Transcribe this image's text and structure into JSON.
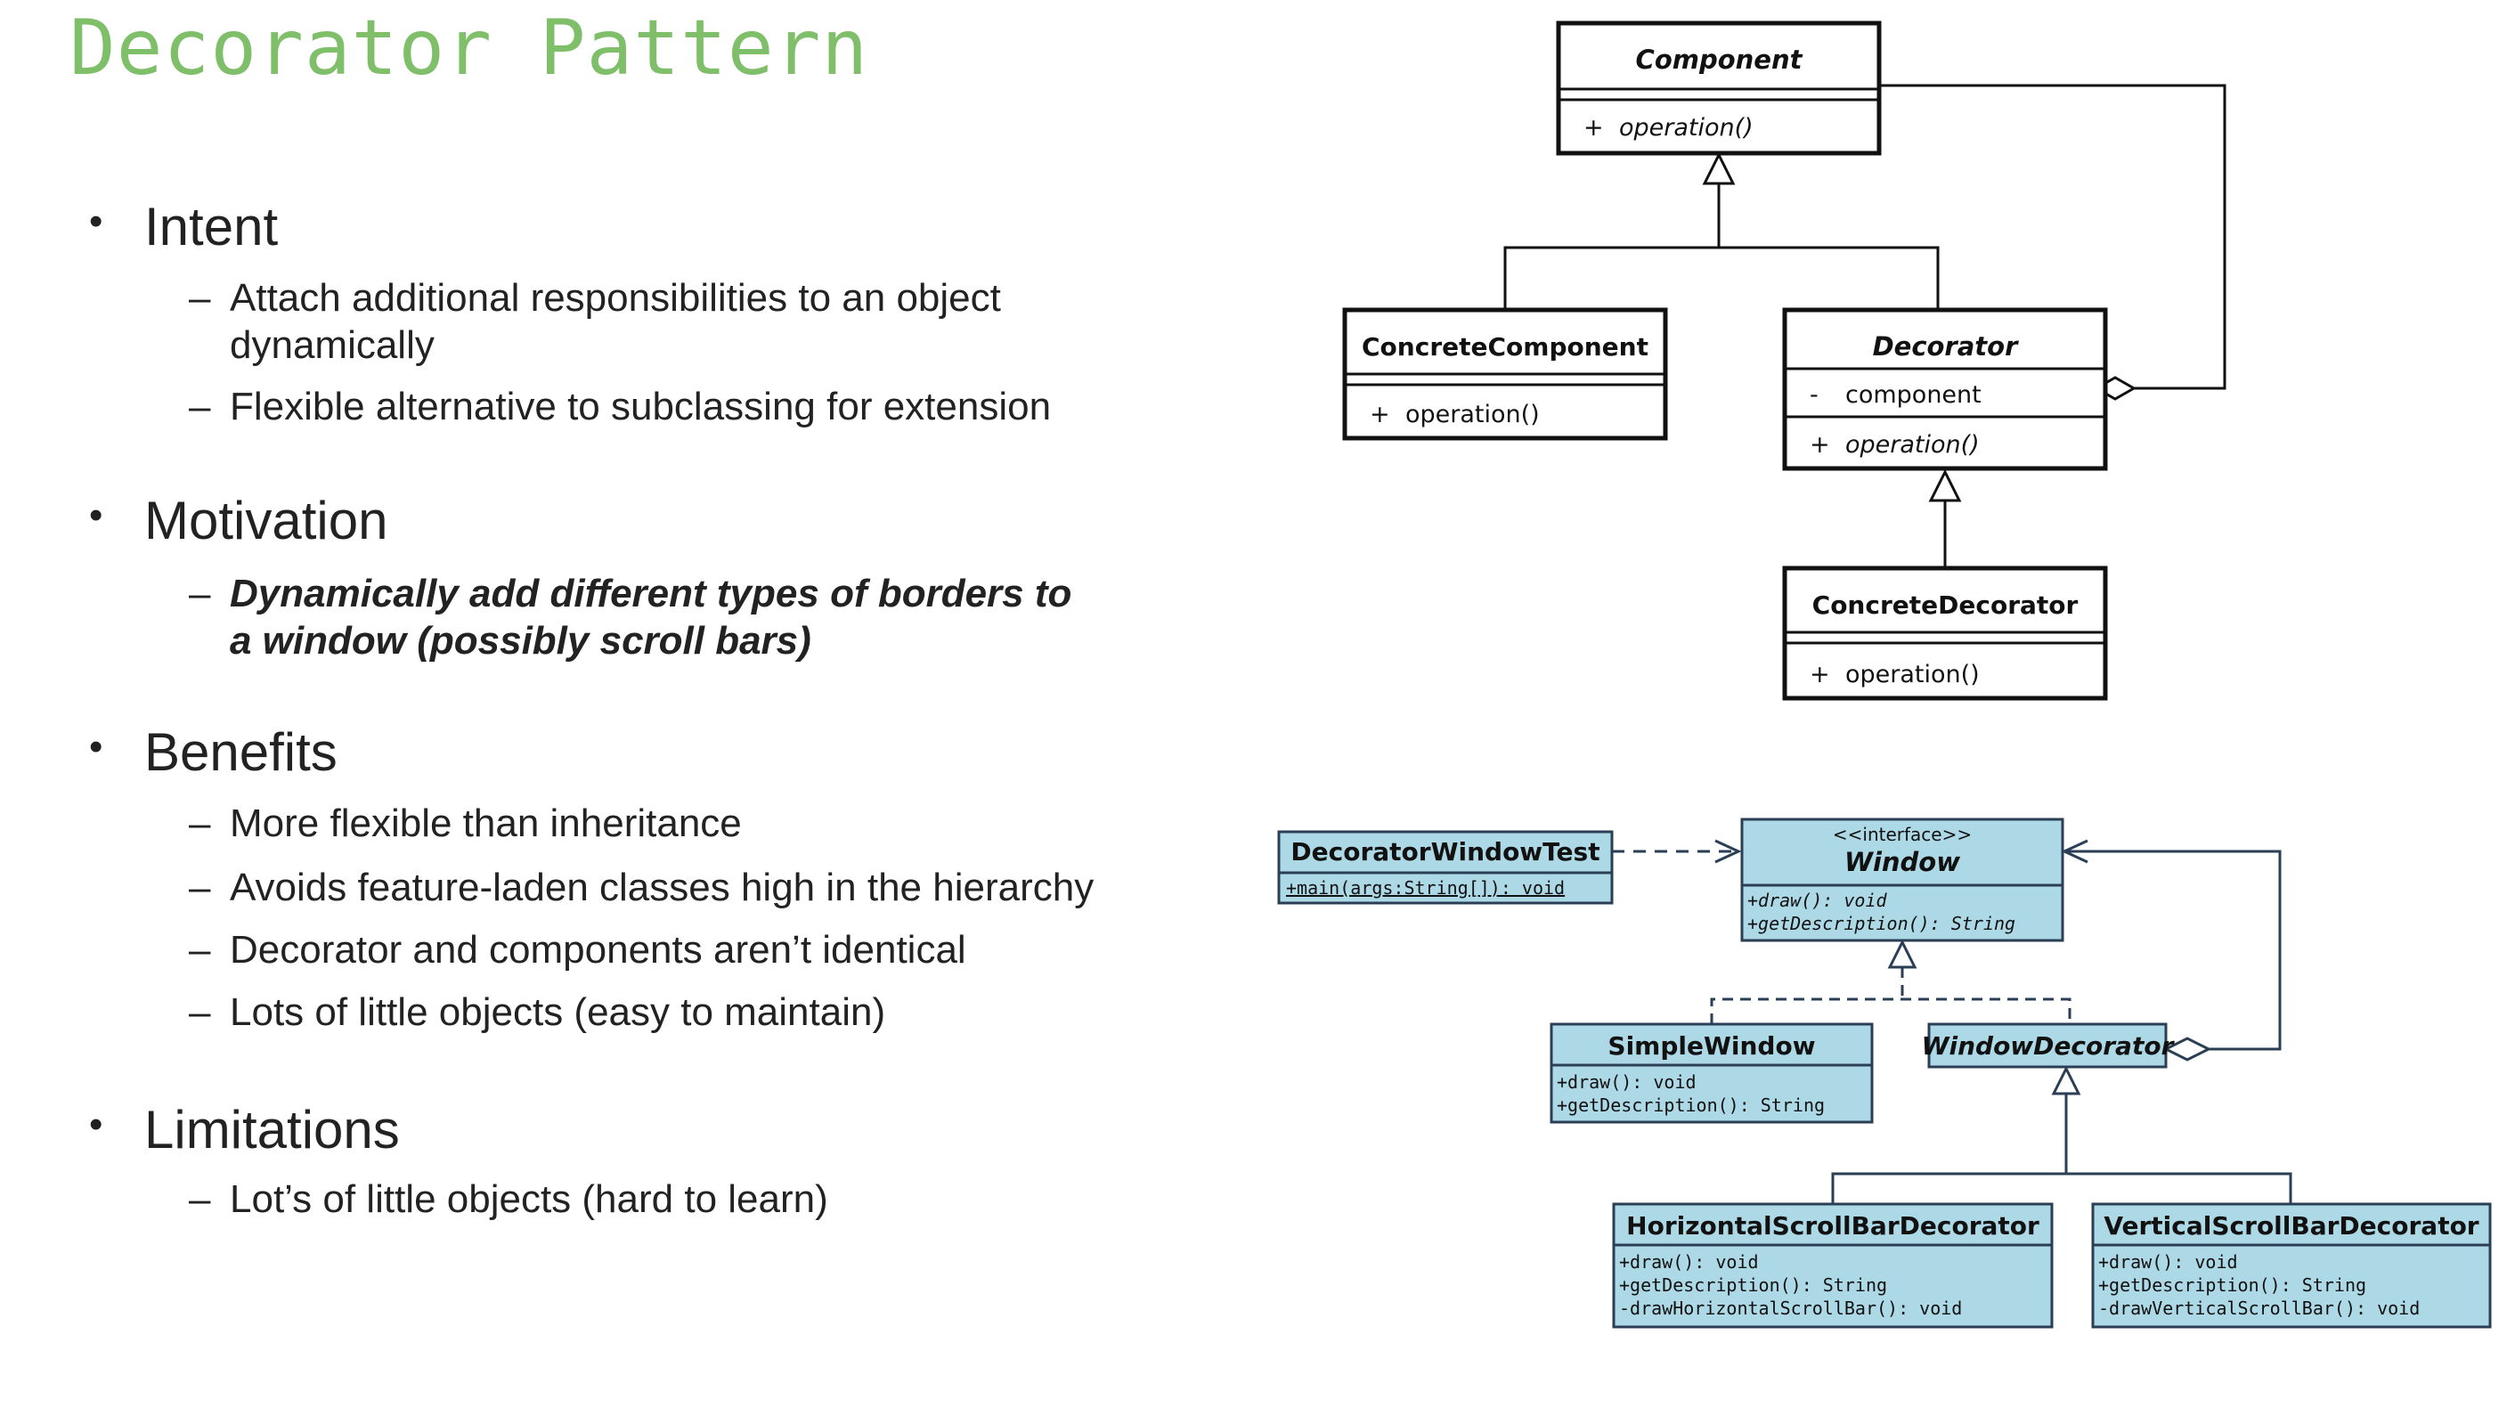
{
  "slide": {
    "title": "Decorator Pattern"
  },
  "outline": [
    {
      "heading": "Intent",
      "items": [
        {
          "lines": [
            "Attach additional responsibilities to an object",
            "dynamically"
          ]
        },
        {
          "lines": [
            "Flexible alternative to subclassing for extension"
          ]
        }
      ]
    },
    {
      "heading": "Motivation",
      "items": [
        {
          "lines": [
            "Dynamically add different types of borders to",
            "a window (possibly scroll bars)"
          ],
          "emphasis": true
        }
      ]
    },
    {
      "heading": "Benefits",
      "items": [
        {
          "lines": [
            "More flexible than inheritance"
          ]
        },
        {
          "lines": [
            "Avoids feature-laden classes high in the hierarchy"
          ]
        },
        {
          "lines": [
            "Decorator and components aren’t identical"
          ]
        },
        {
          "lines": [
            "Lots of little objects (easy to maintain)"
          ]
        }
      ]
    },
    {
      "heading": "Limitations",
      "items": [
        {
          "lines": [
            "Lot’s of little objects (hard to learn)"
          ]
        }
      ]
    }
  ],
  "bullet_glyph": "•",
  "dash_glyph": "–",
  "uml_generic": {
    "component": {
      "name": "Component",
      "op_vis": "+",
      "op": "operation()"
    },
    "concrete_component": {
      "name": "ConcreteComponent",
      "op_vis": "+",
      "op": "operation()"
    },
    "decorator": {
      "name": "Decorator",
      "attr_vis": "-",
      "attr": "component",
      "op_vis": "+",
      "op": "operation()"
    },
    "concrete_decorator": {
      "name": "ConcreteDecorator",
      "op_vis": "+",
      "op": "operation()"
    }
  },
  "uml_window": {
    "test": {
      "name": "DecoratorWindowTest",
      "ops": [
        "+main(args:String[]): void"
      ]
    },
    "window": {
      "stereotype": "<<interface>>",
      "name": "Window",
      "ops": [
        "+draw(): void",
        "+getDescription(): String"
      ]
    },
    "simple": {
      "name": "SimpleWindow",
      "ops": [
        "+draw(): void",
        "+getDescription(): String"
      ]
    },
    "window_decorator": {
      "name": "WindowDecorator"
    },
    "hscroll": {
      "name": "HorizontalScrollBarDecorator",
      "ops": [
        "+draw(): void",
        "+getDescription(): String",
        "-drawHorizontalScrollBar(): void"
      ]
    },
    "vscroll": {
      "name": "VerticalScrollBarDecorator",
      "ops": [
        "+draw(): void",
        "+getDescription(): String",
        "-drawVerticalScrollBar(): void"
      ]
    }
  },
  "colors": {
    "title": "#7fbf6a",
    "uml_fill": "#add8e6",
    "uml_stroke": "#2a3f55"
  }
}
